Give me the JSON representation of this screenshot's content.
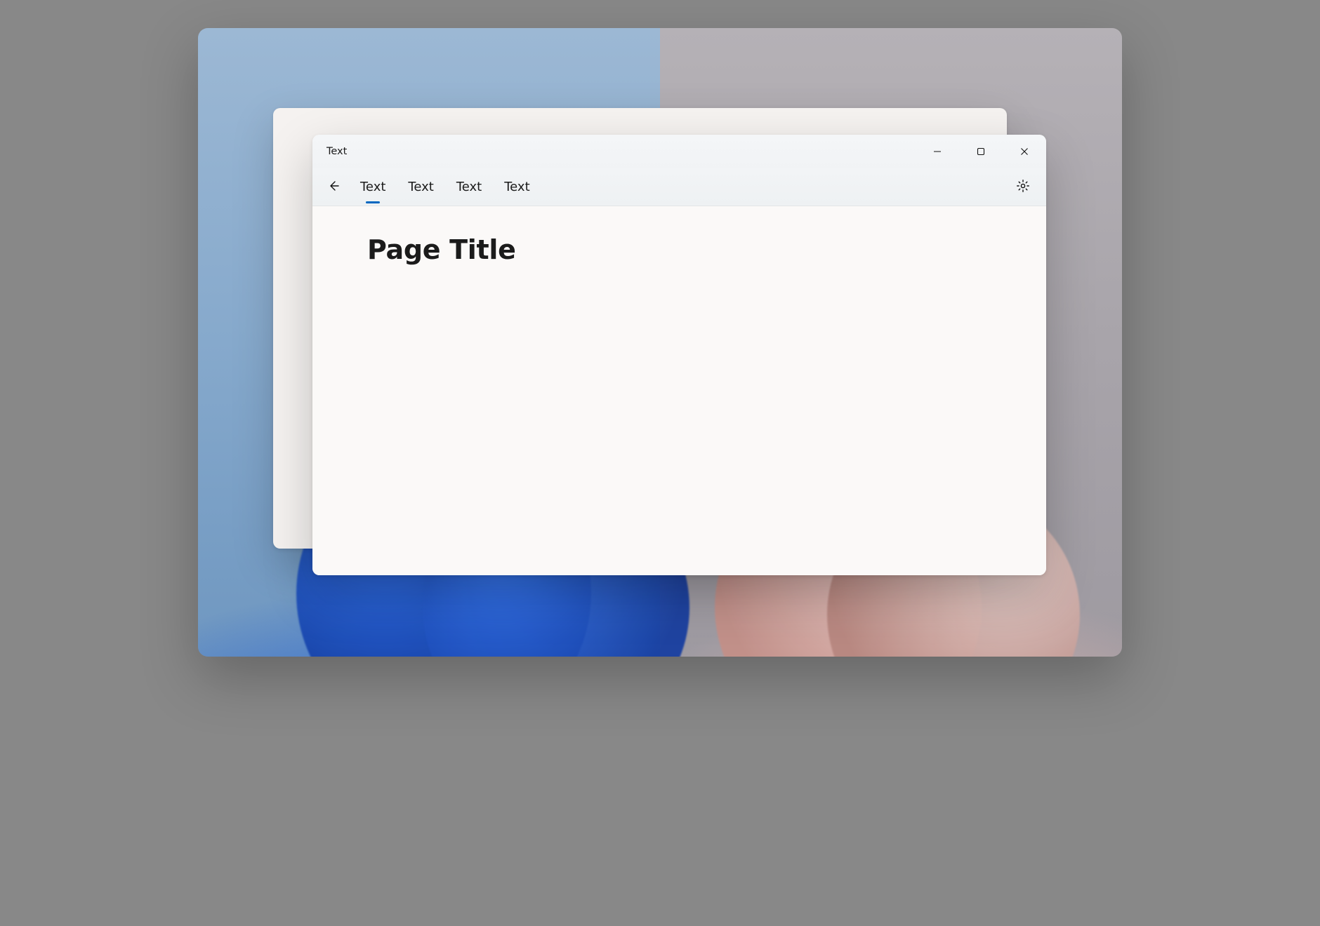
{
  "window": {
    "title": "Text"
  },
  "nav": {
    "tabs": [
      {
        "label": "Text",
        "active": true
      },
      {
        "label": "Text",
        "active": false
      },
      {
        "label": "Text",
        "active": false
      },
      {
        "label": "Text",
        "active": false
      }
    ]
  },
  "page": {
    "heading": "Page Title"
  }
}
